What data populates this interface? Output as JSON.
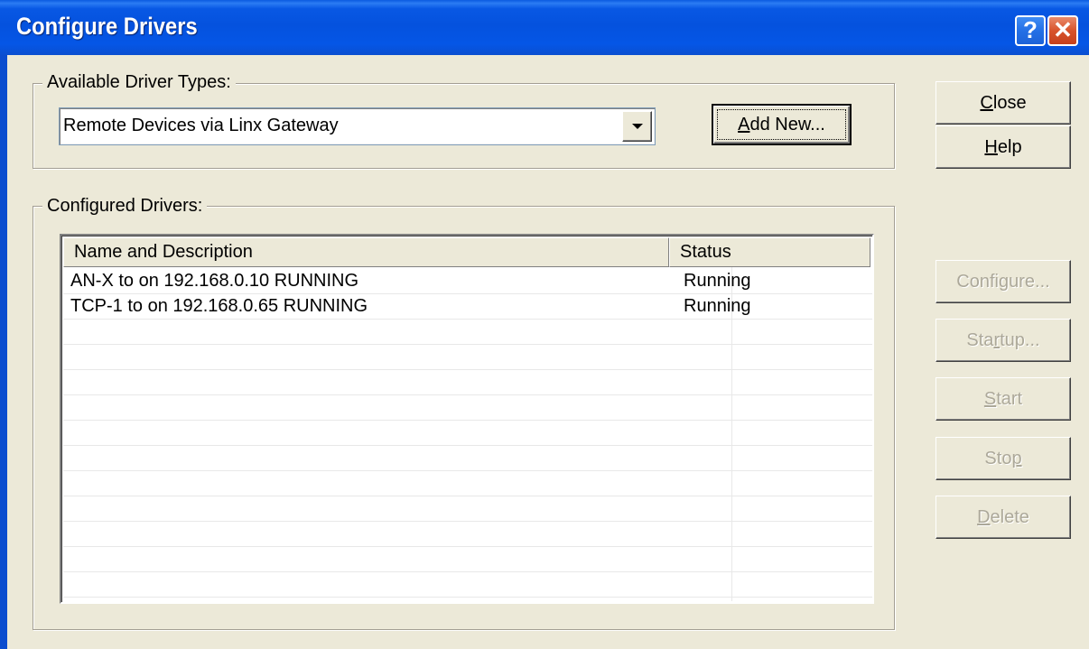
{
  "window": {
    "title": "Configure Drivers",
    "help_button": "?",
    "close_button": "✕"
  },
  "available": {
    "label": "Available Driver Types:",
    "selected": "Remote Devices via Linx Gateway",
    "add_new_pre": "",
    "add_new_mnemonic": "A",
    "add_new_post": "dd New..."
  },
  "configured": {
    "label": "Configured Drivers:",
    "columns": [
      "Name and Description",
      "Status"
    ],
    "rows": [
      {
        "name": "AN-X to  on 192.168.0.10 RUNNING",
        "status": "Running"
      },
      {
        "name": "TCP-1 to  on 192.168.0.65 RUNNING",
        "status": "Running"
      },
      {
        "name": "",
        "status": ""
      },
      {
        "name": "",
        "status": ""
      },
      {
        "name": "",
        "status": ""
      },
      {
        "name": "",
        "status": ""
      },
      {
        "name": "",
        "status": ""
      },
      {
        "name": "",
        "status": ""
      },
      {
        "name": "",
        "status": ""
      },
      {
        "name": "",
        "status": ""
      },
      {
        "name": "",
        "status": ""
      },
      {
        "name": "",
        "status": ""
      },
      {
        "name": "",
        "status": ""
      }
    ]
  },
  "side_buttons": {
    "close": {
      "pre": "",
      "mn": "C",
      "post": "lose"
    },
    "help": {
      "pre": "",
      "mn": "H",
      "post": "elp"
    },
    "configure": {
      "pre": "Confi",
      "mn": "g",
      "post": "ure..."
    },
    "startup": {
      "pre": "Sta",
      "mn": "r",
      "post": "tup..."
    },
    "start": {
      "pre": "",
      "mn": "S",
      "post": "tart"
    },
    "stop": {
      "pre": "Sto",
      "mn": "p",
      "post": ""
    },
    "delete": {
      "pre": "",
      "mn": "D",
      "post": "elete"
    }
  },
  "colors": {
    "titlebar": "#0552de",
    "face": "#ece9d8",
    "disabled_text": "#aca899"
  }
}
